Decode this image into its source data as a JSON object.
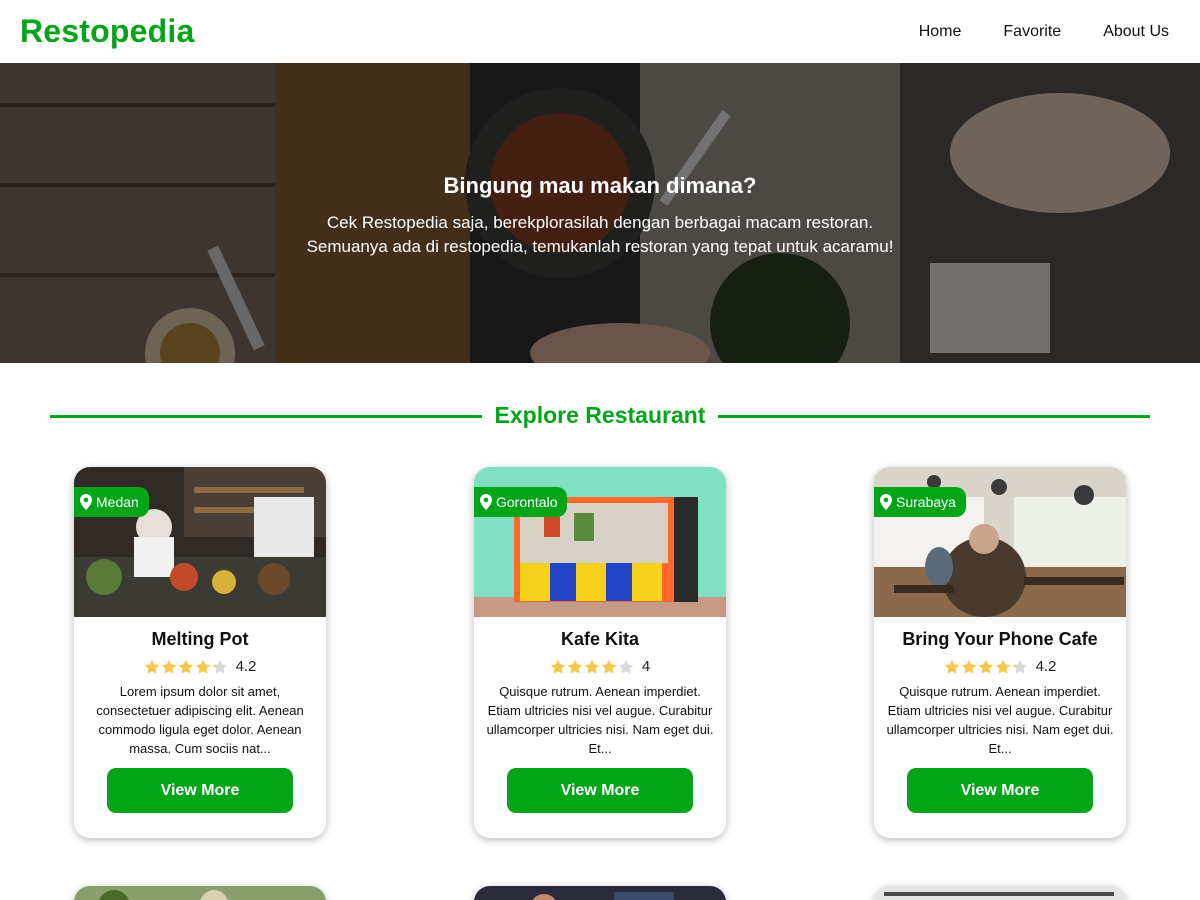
{
  "header": {
    "brand": "Restopedia",
    "nav": [
      {
        "label": "Home"
      },
      {
        "label": "Favorite"
      },
      {
        "label": "About Us"
      }
    ]
  },
  "hero": {
    "title": "Bingung mau makan dimana?",
    "line1": "Cek Restopedia saja, berekplorasilah dengan berbagai macam restoran.",
    "line2": "Semuanya ada di restopedia, temukanlah restoran yang tepat untuk acaramu!"
  },
  "section": {
    "title": "Explore Restaurant",
    "accent": "#04a518"
  },
  "restaurants": [
    {
      "city": "Medan",
      "name": "Melting Pot",
      "rating": "4.2",
      "stars_filled": 4.2,
      "description": "Lorem ipsum dolor sit amet, consectetuer adipiscing elit. Aenean commodo ligula eget dolor. Aenean massa. Cum sociis nat...",
      "button": "View More",
      "image_icon": "kitchen-photo"
    },
    {
      "city": "Gorontalo",
      "name": "Kafe Kita",
      "rating": "4",
      "stars_filled": 4,
      "description": "Quisque rutrum. Aenean imperdiet. Etiam ultricies nisi vel augue. Curabitur ullamcorper ultricies nisi. Nam eget dui. Et...",
      "button": "View More",
      "image_icon": "storefront-photo"
    },
    {
      "city": "Surabaya",
      "name": "Bring Your Phone Cafe",
      "rating": "4.2",
      "stars_filled": 4.2,
      "description": "Quisque rutrum. Aenean imperdiet. Etiam ultricies nisi vel augue. Curabitur ullamcorper ultricies nisi. Nam eget dui. Et...",
      "button": "View More",
      "image_icon": "cafe-interior-photo"
    }
  ],
  "colors": {
    "brand": "#04a518",
    "star": "#f2c94c",
    "star_empty": "#d9d9d9"
  }
}
